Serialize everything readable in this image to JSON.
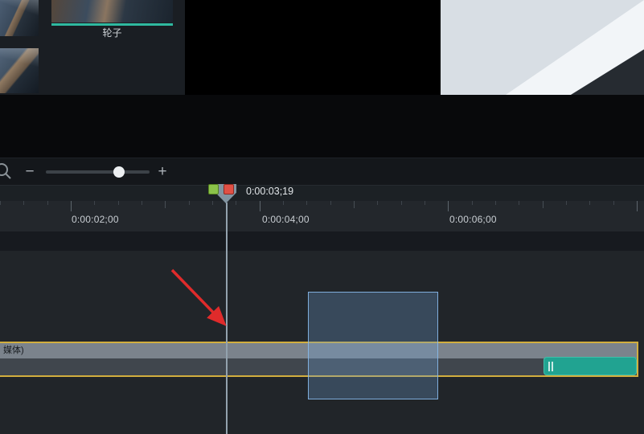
{
  "media_panel": {
    "selected_item_label": "轮子"
  },
  "playback": {
    "timestamp": "0:00:03;19"
  },
  "ruler": {
    "labels": [
      "0:00:02;00",
      "0:00:04;00",
      "0:00:06;00"
    ]
  },
  "track": {
    "clip_label": "媒体)"
  },
  "icons": {
    "minus": "−",
    "plus": "+",
    "chevron_left": "‹",
    "chevron_right": "›",
    "magnifier": "zoom-icon",
    "play": "play-triangle",
    "prev_frame": "step-back",
    "next_frame": "step-forward"
  },
  "colors": {
    "accent_teal": "#2fb9a0",
    "clip_selection_yellow": "#d2ae3e",
    "playhead_green": "#8bc34a",
    "playhead_red": "#e05045",
    "annotation_arrow_red": "#e02b2b",
    "selection_blue": "#6ea0d2",
    "teal_clip": "#21a391"
  }
}
